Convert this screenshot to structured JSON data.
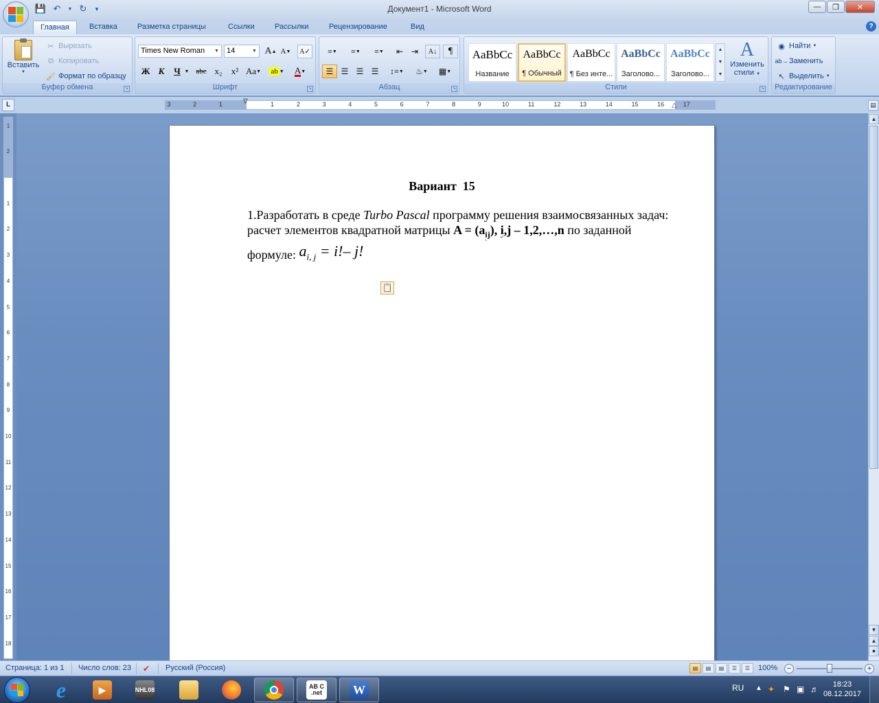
{
  "window": {
    "title": "Документ1 - Microsoft Word",
    "minimize": "—",
    "maximize": "❐",
    "close": "✕"
  },
  "qat": {
    "save_icon": "save-icon",
    "undo_icon": "undo-icon",
    "redo_icon": "redo-icon"
  },
  "tabs": [
    {
      "label": "Главная",
      "active": true
    },
    {
      "label": "Вставка"
    },
    {
      "label": "Разметка страницы"
    },
    {
      "label": "Ссылки"
    },
    {
      "label": "Рассылки"
    },
    {
      "label": "Рецензирование"
    },
    {
      "label": "Вид"
    }
  ],
  "clipboard": {
    "paste_label": "Вставить",
    "cut_label": "Вырезать",
    "copy_label": "Копировать",
    "format_painter_label": "Формат по образцу",
    "group_label": "Буфер обмена"
  },
  "font": {
    "name": "Times New Roman",
    "size": "14",
    "group_label": "Шрифт",
    "bold": "Ж",
    "italic": "К",
    "underline": "Ч",
    "strike": "abc",
    "subscript": "x₂",
    "superscript": "x²",
    "case": "Aa",
    "grow": "A",
    "shrink": "A",
    "color_letter": "A"
  },
  "paragraph": {
    "group_label": "Абзац"
  },
  "styles": {
    "group_label": "Стили",
    "items": [
      {
        "sample": "AaBbCc",
        "name": "Название"
      },
      {
        "sample": "AaBbCc",
        "name": "¶ Обычный",
        "selected": true
      },
      {
        "sample": "AaBbCc",
        "name": "¶ Без инте..."
      },
      {
        "sample": "AaBbCc",
        "name": "Заголово..."
      },
      {
        "sample": "AaBbCc",
        "name": "Заголово..."
      }
    ],
    "change_styles_label_1": "Изменить",
    "change_styles_label_2": "стили"
  },
  "editing": {
    "find_label": "Найти",
    "replace_label": "Заменить",
    "select_label": "Выделить",
    "group_label": "Редактирование"
  },
  "ruler": {
    "h_numbers": [
      "3",
      "2",
      "1",
      "1",
      "2",
      "3",
      "4",
      "5",
      "6",
      "7",
      "8",
      "9",
      "10",
      "11",
      "12",
      "13",
      "14",
      "15",
      "16",
      "17"
    ],
    "v_numbers": [
      "1",
      "2",
      "1",
      "2",
      "3",
      "4",
      "5",
      "6",
      "7",
      "8",
      "9",
      "10",
      "11",
      "12",
      "13",
      "14",
      "15",
      "16",
      "17",
      "18"
    ]
  },
  "document": {
    "title": "Вариант  15",
    "p1_prefix": "1.Разработать в среде ",
    "p1_italic": "Turbo Pascal",
    "p1_suffix": " программу решения взаимосвязанных задач:",
    "p2_prefix": "расчет элементов квадратной матрицы ",
    "p2_matrix": "A = (a",
    "p2_sub": "ij",
    "p2_after_sub": "), ",
    "p2_ij": "i,j",
    "p2_range": " – 1,2,…,n",
    "p2_suffix": " по заданной",
    "p3_prefix": "формуле: ",
    "formula_a": "a",
    "formula_sub": "i, j",
    "formula_rest": " = i!– j!"
  },
  "status": {
    "page": "Страница: 1 из 1",
    "words": "Число слов: 23",
    "language": "Русский (Россия)",
    "zoom": "100%"
  },
  "taskbar": {
    "apps": [
      "internet-explorer",
      "media-player",
      "nhl-08",
      "file-explorer",
      "firefox",
      "chrome",
      "abc-net",
      "word"
    ],
    "nhl_label": "NHL08",
    "abc_label": "AB C .net",
    "word_label": "W",
    "lang": "RU",
    "time": "18:23",
    "date": "08.12.2017"
  }
}
